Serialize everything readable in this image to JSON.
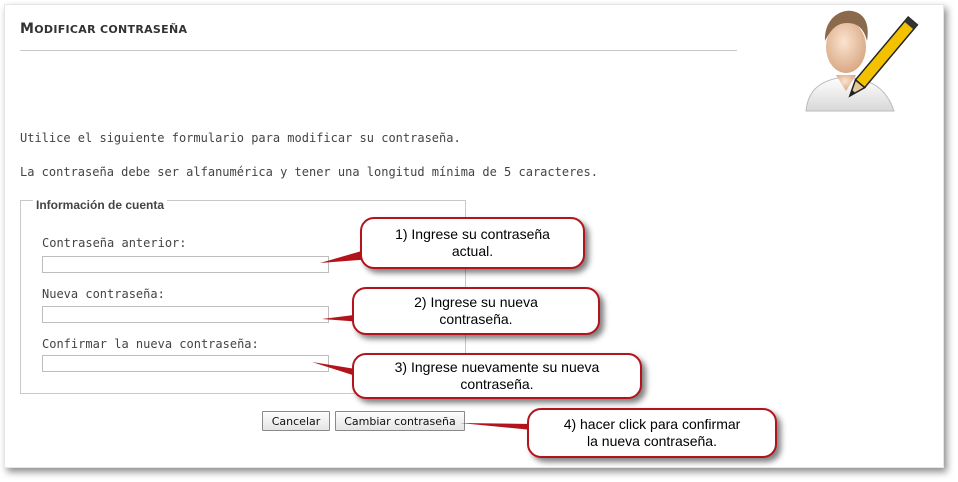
{
  "page": {
    "title_first": "M",
    "title_rest": "ODIFICAR CONTRASEÑA",
    "intro_line1": "Utilice el siguiente formulario para modificar su contraseña.",
    "intro_line2": "La contraseña debe ser alfanumérica y tener una longitud mínima de 5 caracteres."
  },
  "form": {
    "legend": "Información de cuenta",
    "fields": [
      {
        "label": "Contraseña anterior:",
        "value": ""
      },
      {
        "label": "Nueva contraseña:",
        "value": ""
      },
      {
        "label": "Confirmar la nueva contraseña:",
        "value": ""
      }
    ],
    "cancel_label": "Cancelar",
    "submit_label": "Cambiar contraseña"
  },
  "callouts": [
    {
      "line1": "1) Ingrese su contraseña",
      "line2": "actual."
    },
    {
      "line1": "2) Ingrese su nueva",
      "line2": "contraseña."
    },
    {
      "line1": "3) Ingrese nuevamente su nueva",
      "line2": "contraseña."
    },
    {
      "line1": "4) hacer click para confirmar",
      "line2": "la nueva contraseña."
    }
  ],
  "colors": {
    "callout_border": "#b3141b",
    "pencil": "#f2c200"
  },
  "icons": {
    "avatar": "user-edit-icon"
  }
}
